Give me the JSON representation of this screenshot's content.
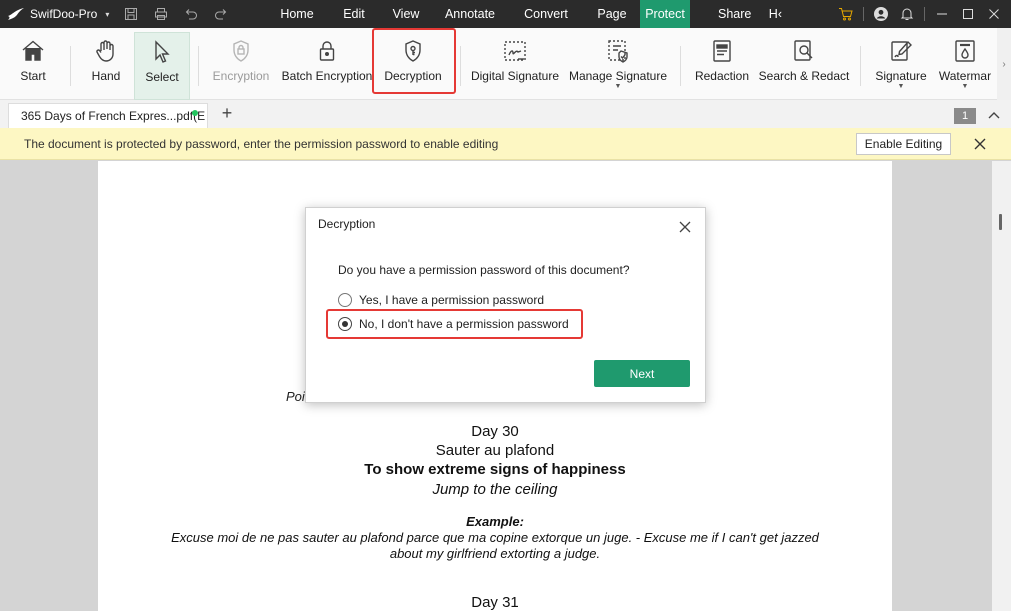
{
  "app": {
    "name": "SwifDoo-Pro",
    "menu_dropdown": "▾"
  },
  "menus": [
    {
      "label": "Home"
    },
    {
      "label": "Edit"
    },
    {
      "label": "View"
    },
    {
      "label": "Annotate"
    },
    {
      "label": "Convert"
    },
    {
      "label": "Page"
    },
    {
      "label": "Protect",
      "active": true
    },
    {
      "label": "Share"
    },
    {
      "label": "H‹"
    }
  ],
  "ribbon": {
    "start": "Start",
    "hand": "Hand",
    "select": "Select",
    "encryption": "Encryption",
    "batch_encryption": "Batch Encryption",
    "decryption": "Decryption",
    "digital_signature": "Digital Signature",
    "manage_signature": "Manage Signature",
    "redaction": "Redaction",
    "search_redact": "Search & Redact",
    "signature": "Signature",
    "watermark": "Watermar"
  },
  "tabs": {
    "doc_tab": "365 Days of French Expres...pdf(E",
    "add": "+",
    "page_number": "1"
  },
  "notice": {
    "text": "The document is protected by password, enter the permission password to enable editing",
    "enable_editing": "Enable Editing"
  },
  "document": {
    "partial_line": "Poi",
    "day30": "Day 30",
    "phrase": "Sauter au plafond",
    "meaning": "To show extreme signs of happiness",
    "literal": "Jump to the ceiling",
    "example_heading": "Example:",
    "example_line1": "Excuse moi de ne pas sauter au plafond parce que ma copine extorque un juge. - Excuse me if I can't get jazzed",
    "example_line2": "about my girlfriend extorting a judge.",
    "day31": "Day 31"
  },
  "dialog": {
    "title": "Decryption",
    "question": "Do you have a permission password of this document?",
    "option_yes": "Yes, I have a permission password",
    "option_no": "No, I don't have a permission password",
    "selected": "no",
    "next": "Next"
  },
  "colors": {
    "accent": "#1f9a6e",
    "titlebar": "#2b2b2b",
    "notice_bg": "#fdf7c3",
    "highlight": "#e53935"
  }
}
